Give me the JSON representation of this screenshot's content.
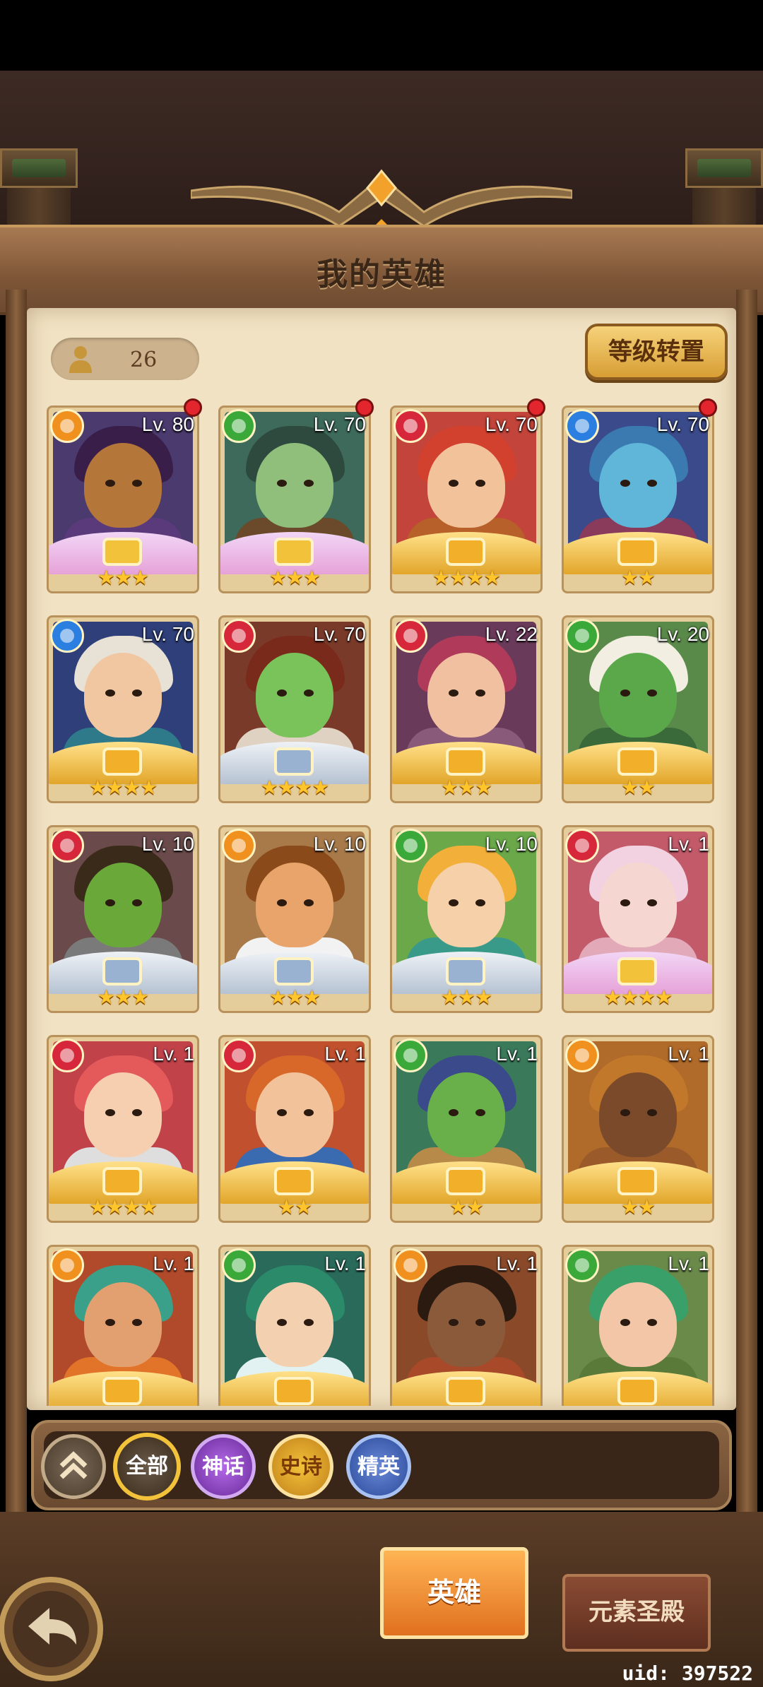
{
  "header": {
    "title": "我的英雄"
  },
  "hero_count": "26",
  "reset_button": "等级转置",
  "colors": {
    "red": "#d6283a",
    "green": "#3aa93a",
    "blue": "#2b7fe0",
    "orange": "#f0901e"
  },
  "heroes": [
    {
      "lv": "Lv. 80",
      "stars": "★★★",
      "element": "orange",
      "elem_icon": "orange-element-icon",
      "red_dot": true,
      "wing": "pink",
      "bg": "#4a3a6e",
      "skin": "#b5763a",
      "hair": "#3a1e4a",
      "body": "#5a3a7a"
    },
    {
      "lv": "Lv. 70",
      "stars": "★★★",
      "element": "green",
      "elem_icon": "green-element-icon",
      "red_dot": true,
      "wing": "pink",
      "bg": "#3d6a5a",
      "skin": "#8fbf7a",
      "hair": "#2e4a3e",
      "body": "#6a4a2a"
    },
    {
      "lv": "Lv. 70",
      "stars": "★★★★",
      "element": "red",
      "elem_icon": "red-element-icon",
      "red_dot": true,
      "wing": "gold",
      "bg": "#c2443a",
      "skin": "#f2c29a",
      "hair": "#d2402e",
      "body": "#b8602a"
    },
    {
      "lv": "Lv. 70",
      "stars": "★★",
      "element": "blue",
      "elem_icon": "blue-element-icon",
      "red_dot": true,
      "wing": "gold",
      "bg": "#3a4a8a",
      "skin": "#5fb6d8",
      "hair": "#3a7ab0",
      "body": "#8a3a5a"
    },
    {
      "lv": "Lv. 70",
      "stars": "★★★★",
      "element": "blue",
      "elem_icon": "blue-element-icon",
      "red_dot": false,
      "wing": "gold",
      "bg": "#2e3f7a",
      "skin": "#f0c7a0",
      "hair": "#e8e2d6",
      "body": "#2f7a8a"
    },
    {
      "lv": "Lv. 70",
      "stars": "★★★★",
      "element": "red",
      "elem_icon": "red-element-icon",
      "red_dot": false,
      "wing": "silver",
      "bg": "#7a3a2a",
      "skin": "#7ac25a",
      "hair": "#7a2a1a",
      "body": "#e0d2c2"
    },
    {
      "lv": "Lv. 22",
      "stars": "★★★",
      "element": "red",
      "elem_icon": "red-element-icon",
      "red_dot": false,
      "wing": "gold",
      "bg": "#6a3a5a",
      "skin": "#f0c0a0",
      "hair": "#b03a5a",
      "body": "#8a5a7a"
    },
    {
      "lv": "Lv. 20",
      "stars": "★★",
      "element": "green",
      "elem_icon": "green-element-icon",
      "red_dot": false,
      "wing": "gold",
      "bg": "#5a8a4a",
      "skin": "#5aa84a",
      "hair": "#f2eee2",
      "body": "#3a6a3a"
    },
    {
      "lv": "Lv. 10",
      "stars": "★★★",
      "element": "red",
      "elem_icon": "red-element-icon",
      "red_dot": false,
      "wing": "silver",
      "bg": "#6a4a4a",
      "skin": "#6aa83a",
      "hair": "#3a2a1a",
      "body": "#7a7a7a"
    },
    {
      "lv": "Lv. 10",
      "stars": "★★★",
      "element": "orange",
      "elem_icon": "orange-element-icon",
      "red_dot": false,
      "wing": "silver",
      "bg": "#a87a4a",
      "skin": "#e8a46a",
      "hair": "#8a4a1a",
      "body": "#f2f2f2"
    },
    {
      "lv": "Lv. 10",
      "stars": "★★★",
      "element": "green",
      "elem_icon": "green-element-icon",
      "red_dot": false,
      "wing": "silver",
      "bg": "#6aa84a",
      "skin": "#f6d0a8",
      "hair": "#f2b03a",
      "body": "#3a9a8a"
    },
    {
      "lv": "Lv. 1",
      "stars": "★★★★",
      "element": "red",
      "elem_icon": "red-element-icon",
      "red_dot": false,
      "wing": "pink",
      "bg": "#c25a6a",
      "skin": "#f6d6d0",
      "hair": "#f2d2e0",
      "body": "#e2aab8"
    },
    {
      "lv": "Lv. 1",
      "stars": "★★★★",
      "element": "red",
      "elem_icon": "red-element-icon",
      "red_dot": false,
      "wing": "gold",
      "bg": "#c2424a",
      "skin": "#f6cfb0",
      "hair": "#e45a5a",
      "body": "#dedede"
    },
    {
      "lv": "Lv. 1",
      "stars": "★★",
      "element": "red",
      "elem_icon": "red-element-icon",
      "red_dot": false,
      "wing": "gold",
      "bg": "#c0502e",
      "skin": "#f2c29a",
      "hair": "#d8682a",
      "body": "#3a6ab0"
    },
    {
      "lv": "Lv. 1",
      "stars": "★★",
      "element": "green",
      "elem_icon": "green-element-icon",
      "red_dot": false,
      "wing": "gold",
      "bg": "#3a7a5a",
      "skin": "#6ab04a",
      "hair": "#3a4a8a",
      "body": "#b88a4a"
    },
    {
      "lv": "Lv. 1",
      "stars": "★★",
      "element": "orange",
      "elem_icon": "orange-element-icon",
      "red_dot": false,
      "wing": "gold",
      "bg": "#b06a2a",
      "skin": "#7a4a2a",
      "hair": "#c2782a",
      "body": "#9a5a2a"
    },
    {
      "lv": "Lv. 1",
      "stars": "",
      "element": "orange",
      "elem_icon": "orange-element-icon",
      "red_dot": false,
      "wing": "gold",
      "bg": "#b04a2a",
      "skin": "#e2a070",
      "hair": "#3aa08a",
      "body": "#e2742a"
    },
    {
      "lv": "Lv. 1",
      "stars": "",
      "element": "green",
      "elem_icon": "green-element-icon",
      "red_dot": false,
      "wing": "gold",
      "bg": "#2a6a5a",
      "skin": "#f2d0b0",
      "hair": "#2a8a6a",
      "body": "#e2f2f2"
    },
    {
      "lv": "Lv. 1",
      "stars": "",
      "element": "orange",
      "elem_icon": "orange-element-icon",
      "red_dot": false,
      "wing": "gold",
      "bg": "#8a4a2a",
      "skin": "#8a5a3a",
      "hair": "#2a1a10",
      "body": "#a84a2a"
    },
    {
      "lv": "Lv. 1",
      "stars": "",
      "element": "green",
      "elem_icon": "green-element-icon",
      "red_dot": false,
      "wing": "gold",
      "bg": "#6a8a4a",
      "skin": "#f2c6a6",
      "hair": "#3aa06a",
      "body": "#5a7a3a"
    }
  ],
  "filters": {
    "all": "全部",
    "mythic": "神话",
    "epic": "史诗",
    "elite": "精英"
  },
  "tabs": {
    "hero": "英雄",
    "temple": "元素圣殿"
  },
  "uid": "uid: 397522"
}
